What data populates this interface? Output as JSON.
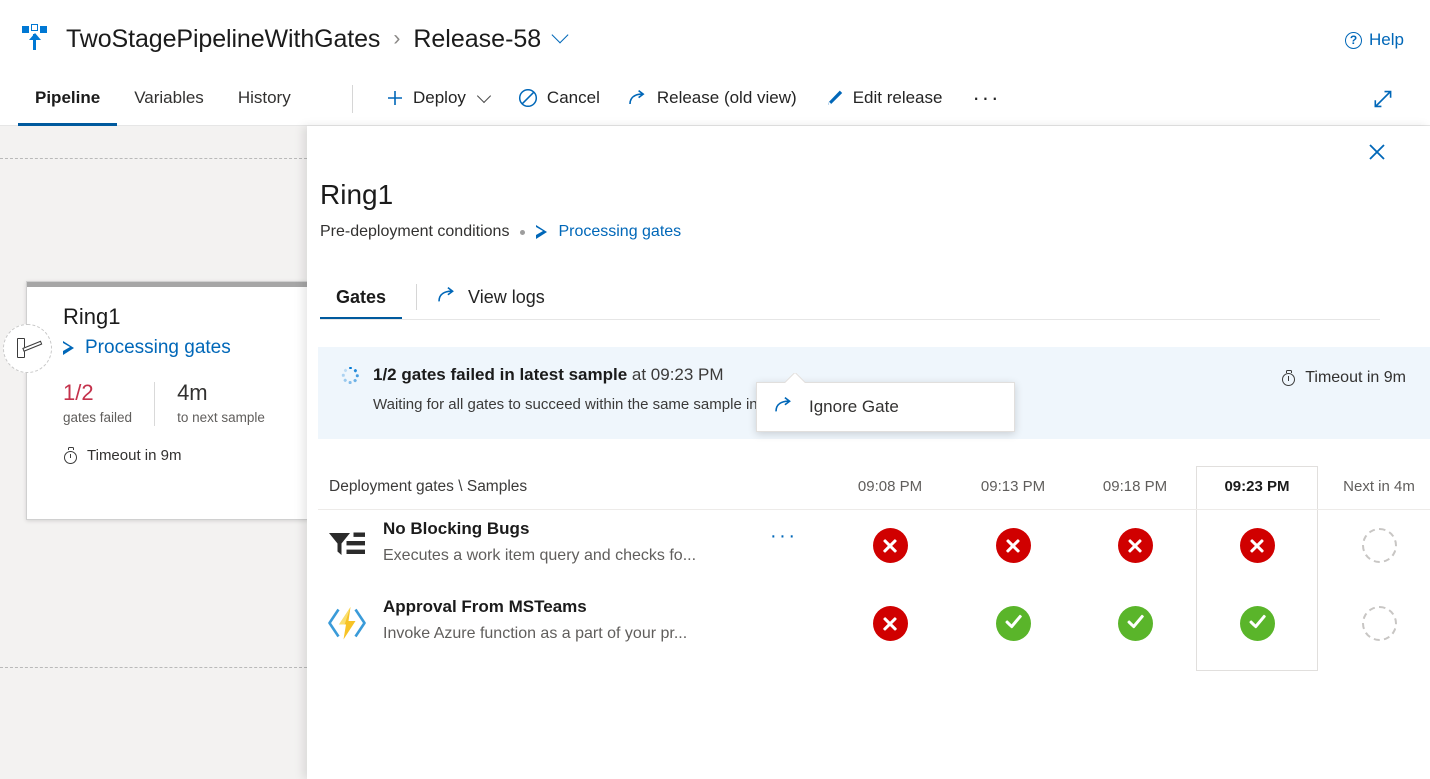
{
  "header": {
    "pipeline_icon": "pipeline-icon",
    "breadcrumb_project": "TwoStagePipelineWithGates",
    "breadcrumb_sep": "›",
    "breadcrumb_release": "Release-58",
    "help_label": "Help",
    "help_icon": "help-circle-icon"
  },
  "commandbar": {
    "tabs": [
      {
        "label": "Pipeline",
        "active": true
      },
      {
        "label": "Variables",
        "active": false
      },
      {
        "label": "History",
        "active": false
      }
    ],
    "actions": [
      {
        "label": "Deploy",
        "icon": "plus-icon",
        "has_chevron": true
      },
      {
        "label": "Cancel",
        "icon": "cancel-circle-icon",
        "has_chevron": false
      },
      {
        "label": "Release (old view)",
        "icon": "open-external-icon",
        "has_chevron": false
      },
      {
        "label": "Edit release",
        "icon": "pencil-icon",
        "has_chevron": false
      }
    ],
    "overflow_label": "···",
    "expand_icon": "expand-diagonal-icon"
  },
  "stage_card": {
    "name": "Ring1",
    "status": "Processing gates",
    "status_icon": "play-triangle-icon",
    "badge_icon": "gate-barrier-icon",
    "metrics": [
      {
        "value": "1/2",
        "label": "gates failed",
        "fail": true
      },
      {
        "value": "4m",
        "label": "to next sample",
        "fail": false
      }
    ],
    "timeout": "Timeout in 9m",
    "timeout_icon": "timer-icon"
  },
  "panel": {
    "close_icon": "close-icon",
    "title": "Ring1",
    "subtitle": "Pre-deployment conditions",
    "sub_status": "Processing gates",
    "sub_status_icon": "play-triangle-icon",
    "tabs": [
      {
        "label": "Gates",
        "active": true
      }
    ],
    "view_logs_label": "View logs",
    "view_logs_icon": "open-external-icon"
  },
  "banner": {
    "spinner_icon": "spinner-icon",
    "primary_bold": "1/2 gates failed in latest sample",
    "primary_rest": " at 09:23 PM",
    "secondary": "Waiting for all gates to succeed within the same sample interval",
    "timeout": "Timeout in 9m",
    "timeout_icon": "timer-icon"
  },
  "gates_table": {
    "row_header_label": "Deployment gates \\ Samples",
    "columns": [
      {
        "label": "09:08 PM",
        "current": false
      },
      {
        "label": "09:13 PM",
        "current": false
      },
      {
        "label": "09:18 PM",
        "current": false
      },
      {
        "label": "09:23 PM",
        "current": true
      },
      {
        "label": "Next in 4m",
        "current": false
      }
    ],
    "rows": [
      {
        "icon": "query-filter-icon",
        "title": "No Blocking Bugs",
        "description": "Executes a work item query and checks fo...",
        "more_label": "···",
        "statuses": [
          "fail",
          "fail",
          "fail",
          "fail",
          "pending"
        ]
      },
      {
        "icon": "azure-function-icon",
        "title": "Approval From MSTeams",
        "description": "Invoke Azure function as a part of your pr...",
        "more_label": "···",
        "statuses": [
          "fail",
          "pass",
          "pass",
          "pass",
          "pending"
        ]
      }
    ]
  },
  "callout": {
    "item_label": "Ignore Gate",
    "item_icon": "open-external-icon"
  },
  "colors": {
    "accent": "#0067b8",
    "tab_underline": "#005a9e",
    "fail": "#d00000",
    "pass": "#5ab52a",
    "fail_text": "#c4314b",
    "banner_bg": "#eff6fc",
    "canvas_bg": "#f3f2f1"
  }
}
